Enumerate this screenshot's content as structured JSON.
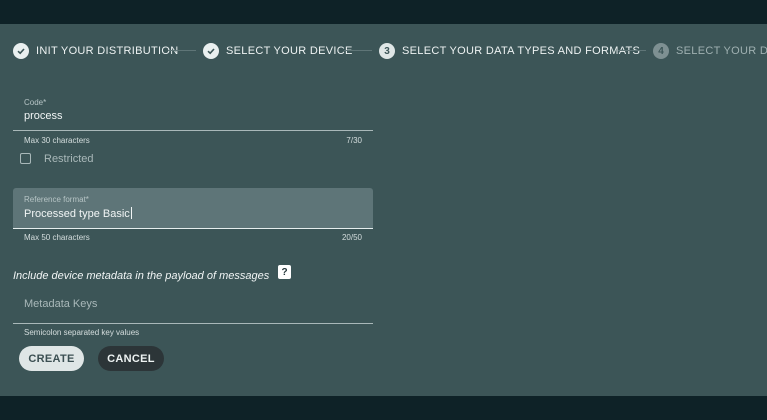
{
  "stepper": {
    "steps": [
      {
        "label": "INIT YOUR DISTRIBUTION",
        "state": "done",
        "icon": "check-icon"
      },
      {
        "label": "SELECT YOUR DEVICE",
        "state": "done",
        "icon": "check-icon"
      },
      {
        "label": "SELECT YOUR DATA TYPES AND FORMATS",
        "state": "active",
        "number": "3"
      },
      {
        "label": "SELECT YOUR DIS",
        "state": "inactive",
        "number": "4"
      }
    ]
  },
  "form": {
    "code": {
      "label": "Code*",
      "value": "process",
      "hint": "Max 30 characters",
      "counter": "7/30"
    },
    "restricted": {
      "label": "Restricted",
      "checked": false
    },
    "reference_format": {
      "label": "Reference format*",
      "value": "Processed type Basic",
      "hint": "Max 50 characters",
      "counter": "20/50"
    },
    "metadata": {
      "title": "Include device metadata in the payload of messages",
      "help_icon": "?",
      "placeholder": "Metadata Keys",
      "hint": "Semicolon separated key values"
    },
    "buttons": {
      "create": "CREATE",
      "cancel": "CANCEL"
    }
  },
  "colors": {
    "panel": "#3c5557",
    "topbar": "#0e2227",
    "filled_field": "#5e7578",
    "create_button": "#dfe6e6",
    "cancel_button": "#2c3538"
  }
}
